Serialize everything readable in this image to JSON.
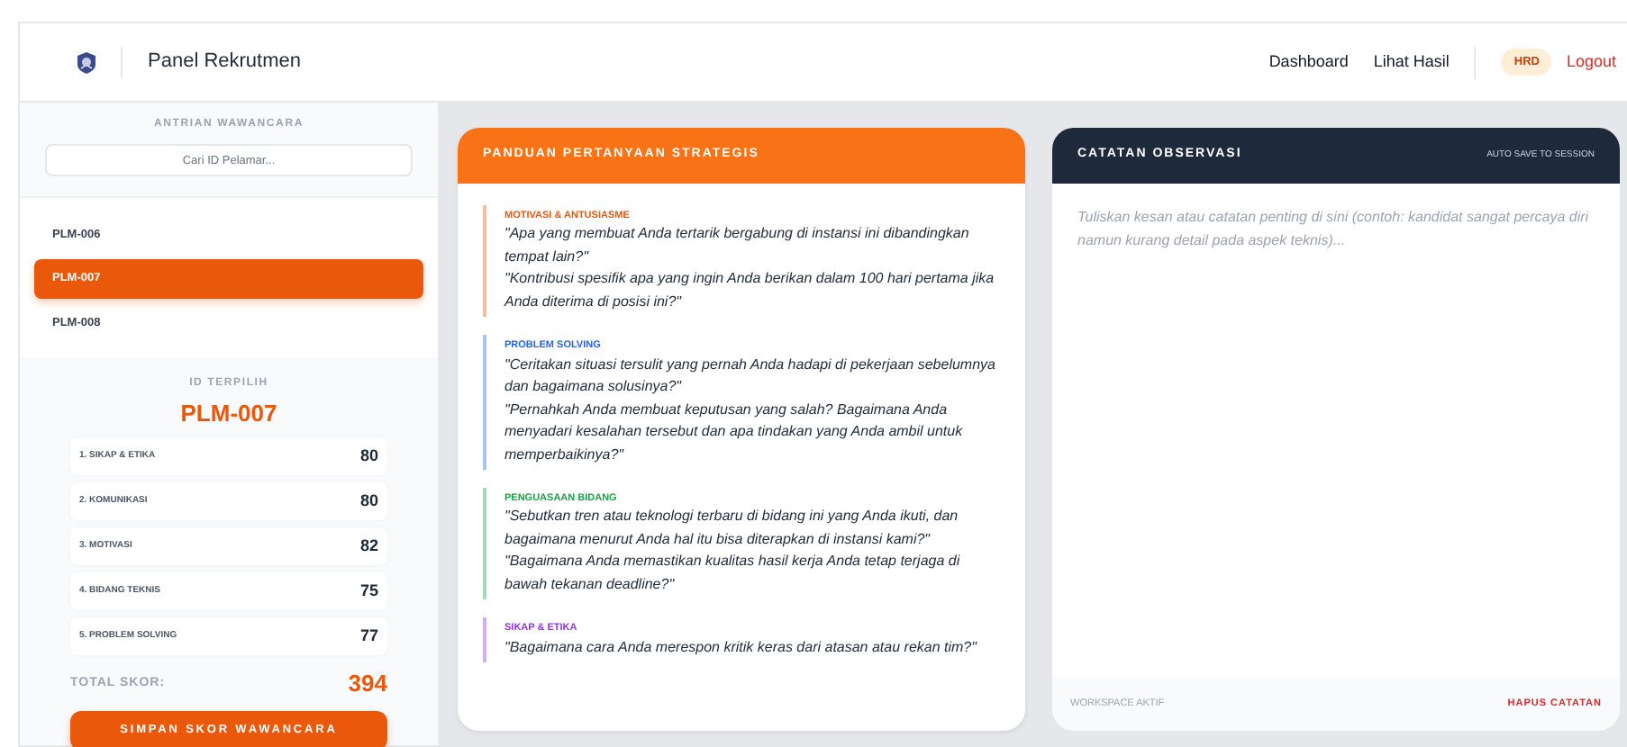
{
  "navbar": {
    "brand": "Panel Rekrutmen",
    "links": [
      "Dashboard",
      "Lihat Hasil"
    ],
    "role_badge": "HRD",
    "logout": "Logout"
  },
  "sidebar": {
    "title": "ANTRIAN WAWANCARA",
    "search": {
      "placeholder": "Cari ID Pelamar..."
    },
    "queue": [
      {
        "id": "PLM-006",
        "selected": false
      },
      {
        "id": "PLM-007",
        "selected": true
      },
      {
        "id": "PLM-008",
        "selected": false
      }
    ],
    "selected_label": "ID TERPILIH",
    "selected_id": "PLM-007",
    "scores": [
      {
        "label": "1. SIKAP & ETIKA",
        "value": "80"
      },
      {
        "label": "2. KOMUNIKASI",
        "value": "80"
      },
      {
        "label": "3. MOTIVASI",
        "value": "82"
      },
      {
        "label": "4. BIDANG TEKNIS",
        "value": "75"
      },
      {
        "label": "5. PROBLEM SOLVING",
        "value": "77"
      }
    ],
    "total_label": "TOTAL SKOR:",
    "total": "394",
    "save_button": "SIMPAN SKOR WAWANCARA"
  },
  "guide": {
    "title": "PANDUAN PERTANYAAN STRATEGIS",
    "sections": [
      {
        "heading": "MOTIVASI & ANTUSIASME",
        "color": "#ea580c",
        "questions": [
          "\"Apa yang membuat Anda tertarik bergabung di instansi ini dibandingkan tempat lain?\"",
          "\"Kontribusi spesifik apa yang ingin Anda berikan dalam 100 hari pertama jika Anda diterima di posisi ini?\""
        ]
      },
      {
        "heading": "PROBLEM SOLVING",
        "color": "#2563eb",
        "questions": [
          "\"Ceritakan situasi tersulit yang pernah Anda hadapi di pekerjaan sebelumnya dan bagaimana solusinya?\"",
          "\"Pernahkah Anda membuat keputusan yang salah? Bagaimana Anda menyadari kesalahan tersebut dan apa tindakan yang Anda ambil untuk memperbaikinya?\""
        ]
      },
      {
        "heading": "PENGUASAAN BIDANG",
        "color": "#16a34a",
        "questions": [
          "\"Sebutkan tren atau teknologi terbaru di bidang ini yang Anda ikuti, dan bagaimana menurut Anda hal itu bisa diterapkan di instansi kami?\"",
          "\"Bagaimana Anda memastikan kualitas hasil kerja Anda tetap terjaga di bawah tekanan deadline?\""
        ]
      },
      {
        "heading": "SIKAP & ETIKA",
        "color": "#9333ea",
        "questions": [
          "\"Bagaimana cara Anda merespon kritik keras dari atasan atau rekan tim?\""
        ]
      }
    ]
  },
  "notes": {
    "title": "CATATAN OBSERVASI",
    "autosave": "AUTO SAVE TO SESSION",
    "placeholder": "Tuliskan kesan atau catatan penting di sini (contoh: kandidat sangat percaya diri namun kurang detail pada aspek teknis)...",
    "footer_label": "WORKSPACE AKTIF",
    "clear_button": "HAPUS CATATAN"
  }
}
